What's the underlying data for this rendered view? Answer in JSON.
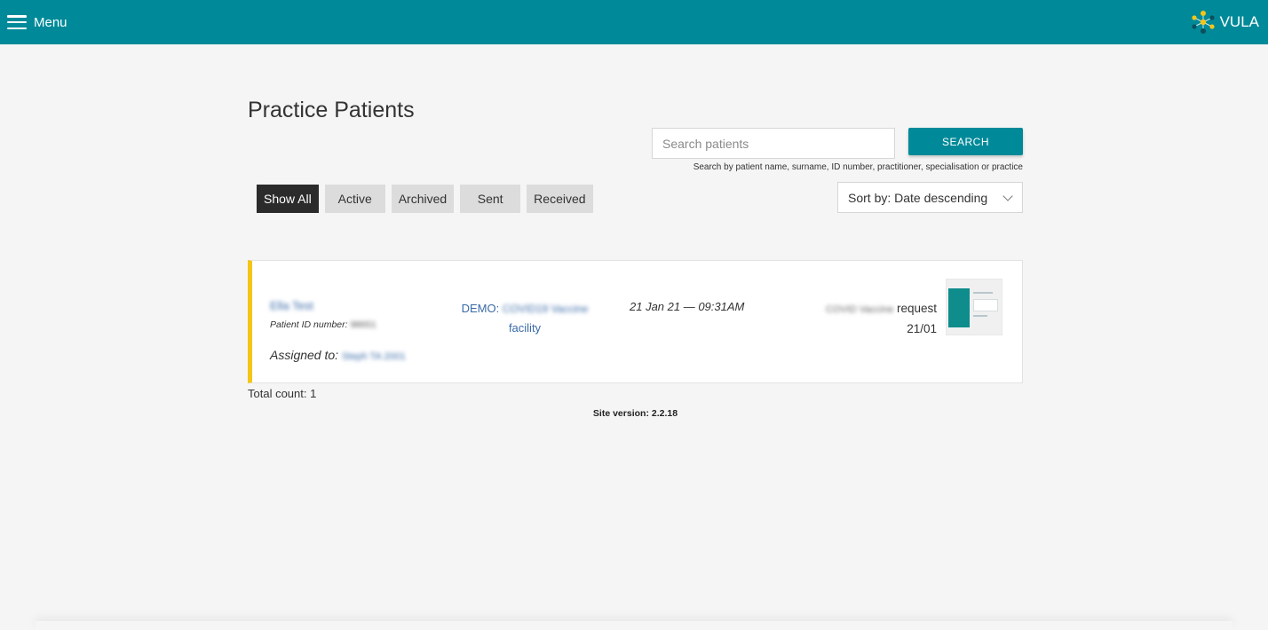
{
  "header": {
    "menu_label": "Menu",
    "brand": "VULA",
    "bar_color": "#008a99"
  },
  "main": {
    "title": "Practice Patients",
    "search": {
      "placeholder": "Search patients",
      "value": "",
      "button_label": "SEARCH",
      "hint": "Search by patient name, surname, ID number, practitioner, specialisation or practice"
    },
    "filters": [
      {
        "label": "Show All",
        "active": true
      },
      {
        "label": "Active",
        "active": false
      },
      {
        "label": "Archived",
        "active": false
      },
      {
        "label": "Sent",
        "active": false
      },
      {
        "label": "Received",
        "active": false
      }
    ],
    "sort": {
      "selected": "Sort by: Date descending"
    },
    "patients": [
      {
        "name": "Ella Test",
        "id_label": "Patient ID number:",
        "id_value": "98651",
        "assigned_label": "Assigned to:",
        "assigned_value": "Steph TA 2001",
        "facility_prefix": "DEMO:",
        "facility_name": "COVID19 Vaccine",
        "facility_suffix": "facility",
        "datetime": "21 Jan 21 — 09:31AM",
        "request_blurred": "COVID Vaccine",
        "request_word": "request",
        "request_date": "21/01",
        "status_color": "#f5c518"
      }
    ],
    "total_count": "Total count: 1",
    "site_version": "Site version: 2.2.18"
  }
}
